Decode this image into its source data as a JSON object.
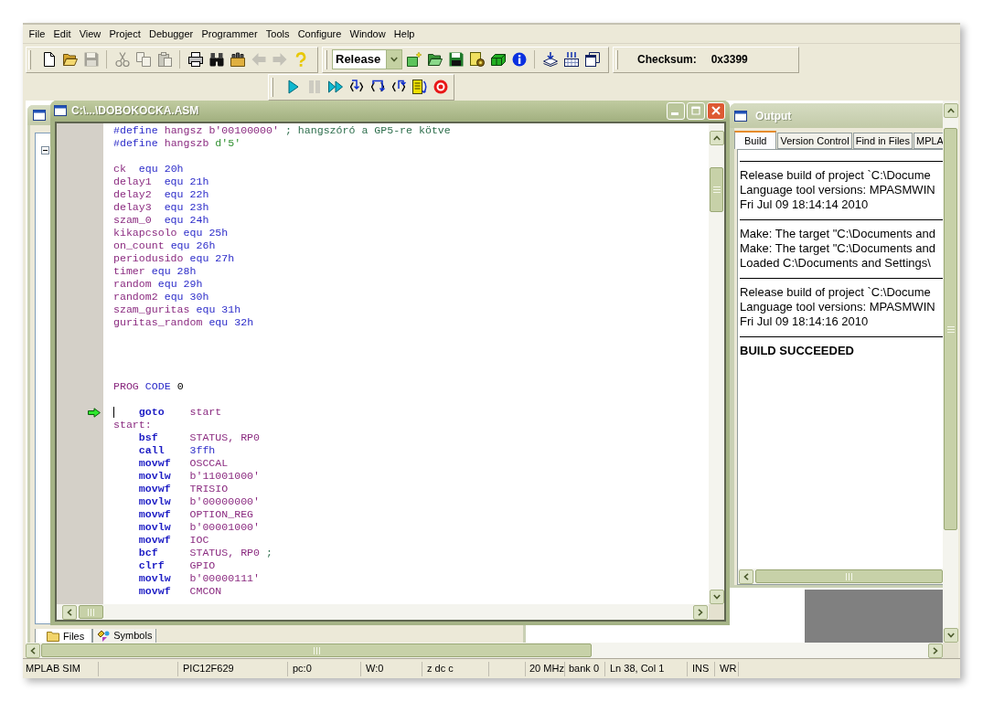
{
  "menu": [
    "File",
    "Edit",
    "View",
    "Project",
    "Debugger",
    "Programmer",
    "Tools",
    "Configure",
    "Window",
    "Help"
  ],
  "toolbar": {
    "standard": [
      {
        "disabled": false
      },
      {
        "disabled": false
      },
      {
        "disabled": true
      },
      {
        "disabled": true
      },
      {
        "disabled": true
      },
      {
        "disabled": true
      },
      {
        "disabled": false
      },
      {
        "disabled": false
      },
      {
        "disabled": false
      },
      {
        "disabled": true
      },
      {
        "disabled": true
      },
      {
        "disabled": false
      }
    ],
    "build_configuration": {
      "value": "Release"
    },
    "project": [
      {
        "disabled": false
      },
      {
        "disabled": false
      },
      {
        "disabled": false
      },
      {
        "disabled": false
      },
      {
        "disabled": false
      },
      {
        "disabled": false
      }
    ],
    "view": [
      {
        "disabled": false
      },
      {
        "disabled": false
      },
      {
        "disabled": false
      }
    ],
    "checksum": {
      "label": "Checksum:",
      "value": "0x3399"
    },
    "debug": [
      {
        "disabled": false
      },
      {
        "disabled": true
      },
      {
        "disabled": false
      },
      {
        "disabled": false
      },
      {
        "disabled": false
      },
      {
        "disabled": false
      },
      {
        "disabled": false
      },
      {
        "disabled": false
      }
    ]
  },
  "project_window": {
    "tabs": [
      {
        "label": "Files",
        "selected": true
      },
      {
        "label": "Symbols",
        "selected": false
      }
    ]
  },
  "editor": {
    "title": "C:\\...\\DOBOKOCKA.ASM",
    "active": true,
    "lines": [
      {
        "kind": "code",
        "tokens": [
          {
            "kind": "kw",
            "text": "#define"
          },
          {
            "kind": "sym",
            "text": "hangsz"
          },
          {
            "kind": "sym",
            "text": "b'00100000'"
          },
          {
            "kind": "cmt",
            "text": "; hangszóró a GP5-re kötve"
          }
        ],
        "current": false
      },
      {
        "kind": "code",
        "tokens": [
          {
            "kind": "kw",
            "text": "#define"
          },
          {
            "kind": "sym",
            "text": "hangszb"
          },
          {
            "kind": "dec",
            "text": "d'5'"
          }
        ],
        "current": false
      },
      {
        "kind": "blank"
      },
      {
        "kind": "code",
        "tokens": [
          {
            "kind": "label",
            "text": "ck"
          },
          {
            "kind": "kw",
            "text": "equ"
          },
          {
            "kind": "num",
            "text": "20h"
          }
        ],
        "current": false
      },
      {
        "kind": "code",
        "tokens": [
          {
            "kind": "label",
            "text": "delay1"
          },
          {
            "kind": "kw",
            "text": "equ"
          },
          {
            "kind": "num",
            "text": "21h"
          }
        ],
        "current": false
      },
      {
        "kind": "code",
        "tokens": [
          {
            "kind": "label",
            "text": "delay2"
          },
          {
            "kind": "kw",
            "text": "equ"
          },
          {
            "kind": "num",
            "text": "22h"
          }
        ],
        "current": false
      },
      {
        "kind": "code",
        "tokens": [
          {
            "kind": "label",
            "text": "delay3"
          },
          {
            "kind": "kw",
            "text": "equ"
          },
          {
            "kind": "num",
            "text": "23h"
          }
        ],
        "current": false
      },
      {
        "kind": "code",
        "tokens": [
          {
            "kind": "label",
            "text": "szam_0"
          },
          {
            "kind": "kw",
            "text": "equ"
          },
          {
            "kind": "num",
            "text": "24h"
          }
        ],
        "current": false
      },
      {
        "kind": "code",
        "tokens": [
          {
            "kind": "sym",
            "text": "kikapcsolo"
          },
          {
            "kind": "kw",
            "text": "equ"
          },
          {
            "kind": "num",
            "text": "25h"
          }
        ],
        "current": false
      },
      {
        "kind": "code",
        "tokens": [
          {
            "kind": "sym",
            "text": "on_count"
          },
          {
            "kind": "kw",
            "text": "equ"
          },
          {
            "kind": "num",
            "text": "26h"
          }
        ],
        "current": false
      },
      {
        "kind": "code",
        "tokens": [
          {
            "kind": "sym",
            "text": "periodusido"
          },
          {
            "kind": "kw",
            "text": "equ"
          },
          {
            "kind": "num",
            "text": "27h"
          }
        ],
        "current": false
      },
      {
        "kind": "code",
        "tokens": [
          {
            "kind": "sym",
            "text": "timer"
          },
          {
            "kind": "kw",
            "text": "equ"
          },
          {
            "kind": "num",
            "text": "28h"
          }
        ],
        "current": false
      },
      {
        "kind": "code",
        "tokens": [
          {
            "kind": "sym",
            "text": "random"
          },
          {
            "kind": "kw",
            "text": "equ"
          },
          {
            "kind": "num",
            "text": "29h"
          }
        ],
        "current": false
      },
      {
        "kind": "code",
        "tokens": [
          {
            "kind": "sym",
            "text": "random2"
          },
          {
            "kind": "kw",
            "text": "equ"
          },
          {
            "kind": "num",
            "text": "30h"
          }
        ],
        "current": false
      },
      {
        "kind": "code",
        "tokens": [
          {
            "kind": "sym",
            "text": "szam_guritas"
          },
          {
            "kind": "kw",
            "text": "equ"
          },
          {
            "kind": "num",
            "text": "31h"
          }
        ],
        "current": false
      },
      {
        "kind": "code",
        "tokens": [
          {
            "kind": "sym",
            "text": "guritas_random"
          },
          {
            "kind": "kw",
            "text": "equ"
          },
          {
            "kind": "num",
            "text": "32h"
          }
        ],
        "current": false
      },
      {
        "kind": "blank"
      },
      {
        "kind": "blank"
      },
      {
        "kind": "blank"
      },
      {
        "kind": "blank"
      },
      {
        "kind": "code",
        "tokens": [
          {
            "kind": "sym",
            "text": "PROG"
          },
          {
            "kind": "kw",
            "text": "CODE"
          },
          {
            "kind": "txt",
            "text": "0"
          }
        ],
        "current": false
      },
      {
        "kind": "blank"
      },
      {
        "kind": "code",
        "tokens": [
          {
            "kind": "op",
            "text": "goto"
          },
          {
            "kind": "sym",
            "text": "start"
          }
        ],
        "current": true
      },
      {
        "kind": "code",
        "tokens": [
          {
            "kind": "sym",
            "text": "start:"
          }
        ],
        "current": false
      },
      {
        "kind": "code",
        "tokens": [
          {
            "kind": "op",
            "text": "bsf"
          },
          {
            "kind": "sym",
            "text": "STATUS, RP0"
          }
        ],
        "current": false
      },
      {
        "kind": "code",
        "tokens": [
          {
            "kind": "op",
            "text": "call"
          },
          {
            "kind": "num",
            "text": "3ffh"
          }
        ],
        "current": false
      },
      {
        "kind": "code",
        "tokens": [
          {
            "kind": "op",
            "text": "movwf"
          },
          {
            "kind": "sym",
            "text": "OSCCAL"
          }
        ],
        "current": false
      },
      {
        "kind": "code",
        "tokens": [
          {
            "kind": "op",
            "text": "movlw"
          },
          {
            "kind": "sym",
            "text": "b'11001000'"
          }
        ],
        "current": false
      },
      {
        "kind": "code",
        "tokens": [
          {
            "kind": "op",
            "text": "movwf"
          },
          {
            "kind": "sym",
            "text": "TRISIO"
          }
        ],
        "current": false
      },
      {
        "kind": "code",
        "tokens": [
          {
            "kind": "op",
            "text": "movlw"
          },
          {
            "kind": "sym",
            "text": "b'00000000'"
          }
        ],
        "current": false
      },
      {
        "kind": "code",
        "tokens": [
          {
            "kind": "op",
            "text": "movwf"
          },
          {
            "kind": "sym",
            "text": "OPTION_REG"
          }
        ],
        "current": false
      },
      {
        "kind": "code",
        "tokens": [
          {
            "kind": "op",
            "text": "movlw"
          },
          {
            "kind": "sym",
            "text": "b'00001000'"
          }
        ],
        "current": false
      },
      {
        "kind": "code",
        "tokens": [
          {
            "kind": "op",
            "text": "movwf"
          },
          {
            "kind": "sym",
            "text": "IOC"
          }
        ],
        "current": false
      },
      {
        "kind": "code",
        "tokens": [
          {
            "kind": "op",
            "text": "bcf"
          },
          {
            "kind": "sym",
            "text": "STATUS, RP0"
          },
          {
            "kind": "cmt",
            "text": ";"
          }
        ],
        "current": false
      },
      {
        "kind": "code",
        "tokens": [
          {
            "kind": "op",
            "text": "clrf"
          },
          {
            "kind": "sym",
            "text": "GPIO"
          }
        ],
        "current": false
      },
      {
        "kind": "code",
        "tokens": [
          {
            "kind": "op",
            "text": "movlw"
          },
          {
            "kind": "sym",
            "text": "b'00000111'"
          }
        ],
        "current": false
      },
      {
        "kind": "code",
        "tokens": [
          {
            "kind": "op",
            "text": "movwf"
          },
          {
            "kind": "sym",
            "text": "CMCON"
          }
        ],
        "current": false
      }
    ]
  },
  "output": {
    "title": "Output",
    "active": false,
    "tabs": [
      {
        "label": "Build",
        "selected": true
      },
      {
        "label": "Version Control",
        "selected": false
      },
      {
        "label": "Find in Files",
        "selected": false
      },
      {
        "label": "MPLA",
        "selected": false
      }
    ],
    "blocks": [
      {
        "kind": "log",
        "lines": [
          "Release build of project `C:\\Docume",
          "Language tool versions: MPASMWIN",
          "Fri Jul 09 18:14:14 2010"
        ]
      },
      {
        "kind": "log",
        "lines": [
          "Make: The target \"C:\\Documents and",
          "Make: The target \"C:\\Documents and",
          "Loaded C:\\Documents and Settings\\"
        ]
      },
      {
        "kind": "log",
        "lines": [
          "Release build of project `C:\\Docume",
          "Language tool versions: MPASMWIN",
          "Fri Jul 09 18:14:16 2010"
        ]
      },
      {
        "kind": "result",
        "lines": [
          "BUILD SUCCEEDED"
        ]
      }
    ]
  },
  "status_bar": [
    "MPLAB SIM",
    "PIC12F629",
    "pc:0",
    "W:0",
    "z dc c",
    "20 MHz",
    "bank 0",
    "Ln 38, Col 1",
    "INS",
    "WR"
  ]
}
